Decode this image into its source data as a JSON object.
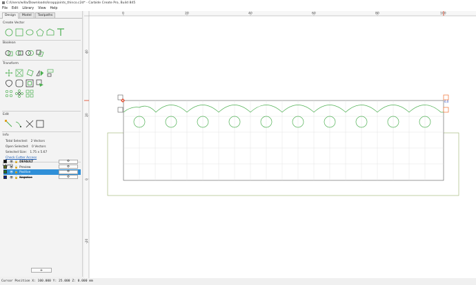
{
  "window": {
    "title": "C:/Users/willa/Downloads/knappjoints_thinco.c2d* - Carbide Create Pro, Build 845"
  },
  "menu": [
    "File",
    "Edit",
    "Library",
    "View",
    "Help"
  ],
  "tabs": [
    "Design",
    "Model",
    "Toolpaths"
  ],
  "sections": {
    "create_vector": "Create Vector",
    "boolean": "Boolean",
    "transform": "Transform",
    "edit": "Edit",
    "info": "Info",
    "layers": "Layers"
  },
  "info": {
    "total_selected": "Total Selected:",
    "total_selected_value": "2 Vectors",
    "open_selected": "Open Selected:",
    "open_selected_value": "0 Vectors",
    "selected_size": "Selected Size:",
    "selected_size_value": "1.75 x 5.67",
    "check_cutter": "Check Cutter Access"
  },
  "layers": [
    {
      "name": "DEFAULT",
      "color": "#111111",
      "selected": false,
      "bold": true,
      "strike": false
    },
    {
      "name": "Preview",
      "color": "#5a6e1a",
      "selected": false,
      "bold": false,
      "strike": false
    },
    {
      "name": "Positive",
      "color": "#1a7a2a",
      "selected": true,
      "bold": false,
      "strike": false
    },
    {
      "name": "Negative",
      "color": "#0c1f8a",
      "selected": false,
      "bold": false,
      "strike": true
    }
  ],
  "layer_gear": "⚙",
  "add_layer": "+",
  "ruler": {
    "top_labels": [
      "0",
      "20",
      "40",
      "60",
      "80",
      "100"
    ],
    "left_labels": [
      "40",
      "20",
      "0",
      "-20",
      "-40",
      "-60"
    ]
  },
  "status": {
    "cursor": "Cursor Position X: 100.000 Y: 25.000 Z: 0.000 mm"
  },
  "colors": {
    "vector": "#4caf50",
    "accent": "#2f8fd8",
    "handle_red": "#e03a1a",
    "handle_orange": "#f07030",
    "origin_label": "#1a3ab5"
  },
  "origin_label": "0,0"
}
